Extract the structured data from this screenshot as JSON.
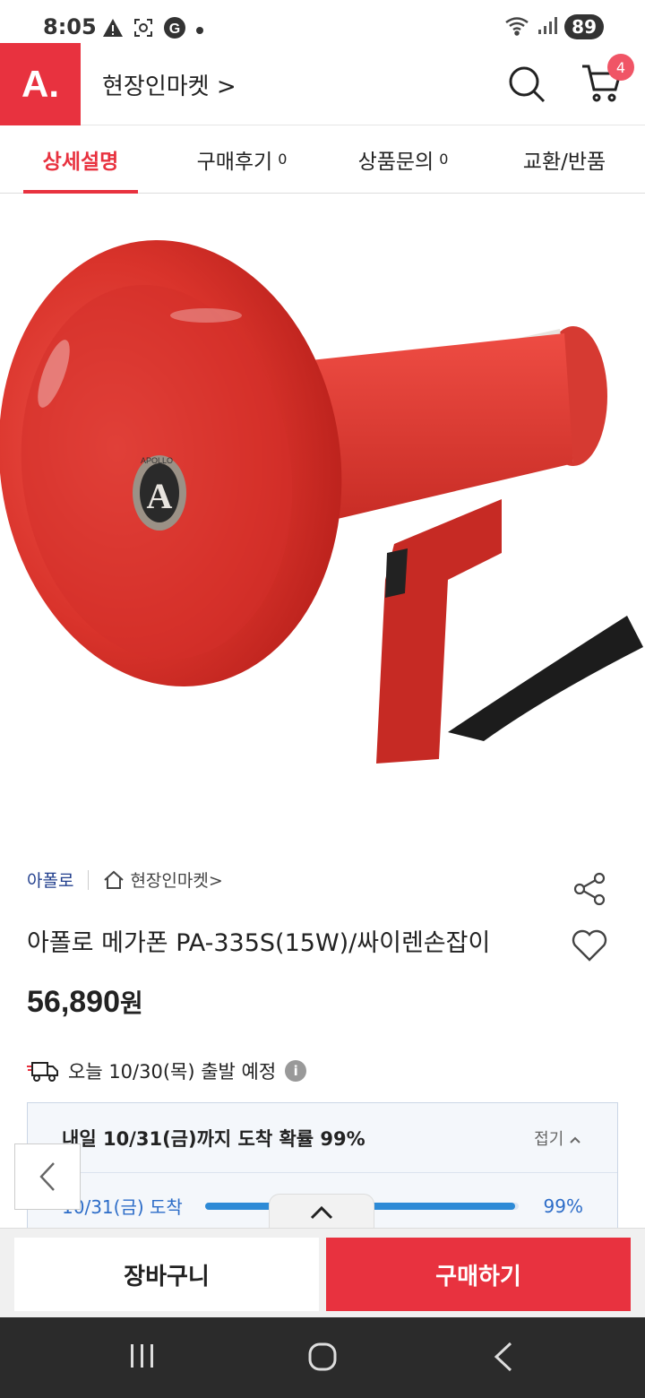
{
  "status_bar": {
    "time": "8:05",
    "battery": "89",
    "left_icons": [
      "warning-icon",
      "screenshot-icon",
      "google-icon",
      "dot-icon"
    ],
    "right_icons": [
      "wifi-icon",
      "signal-icon"
    ]
  },
  "header": {
    "logo": "A.",
    "shop_name": "현장인마켓 >",
    "cart_count": "4"
  },
  "tabs": [
    {
      "label": "상세설명",
      "count": ""
    },
    {
      "label": "구매후기",
      "count": "0"
    },
    {
      "label": "상품문의",
      "count": "0"
    },
    {
      "label": "교환/반품",
      "count": ""
    }
  ],
  "product": {
    "brand": "아폴로",
    "store": "현장인마켓>",
    "title": "아폴로 메가폰 PA-335S(15W)/싸이렌손잡이",
    "price_number": "56,890",
    "price_unit": "원",
    "badge_text": "APOLLO"
  },
  "shipping": {
    "text": "오늘 10/30(목) 출발 예정",
    "info": "i"
  },
  "delivery": {
    "title": "내일 10/31(금)까지 도착 확률 99%",
    "fold_label": "접기",
    "rows": [
      {
        "date": "10/31(금) 도착",
        "percent": 99,
        "percent_label": "99%"
      }
    ]
  },
  "actions": {
    "cart": "장바구니",
    "buy": "구매하기"
  },
  "colors": {
    "accent": "#e8323f",
    "brand_blue": "#23408e",
    "probability_blue": "#2d6dc8"
  }
}
